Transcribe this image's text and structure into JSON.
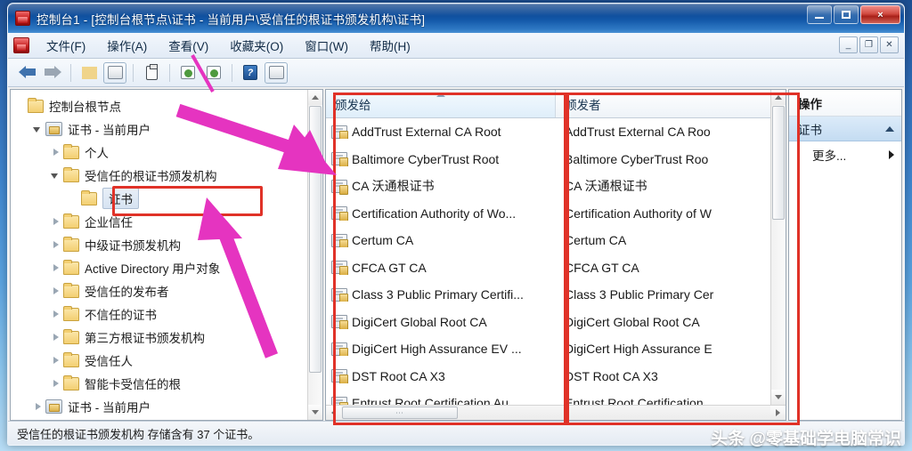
{
  "window": {
    "title": "控制台1 - [控制台根节点\\证书 - 当前用户\\受信任的根证书颁发机构\\证书]",
    "minimize_label": "最小化",
    "restore_label": "还原",
    "close_label": "×",
    "mdi_minimize": "_",
    "mdi_restore": "❐",
    "mdi_close": "✕"
  },
  "menubar": {
    "items": [
      {
        "label": "文件(F)"
      },
      {
        "label": "操作(A)"
      },
      {
        "label": "查看(V)"
      },
      {
        "label": "收藏夹(O)"
      },
      {
        "label": "窗口(W)"
      },
      {
        "label": "帮助(H)"
      }
    ]
  },
  "toolbar": {
    "buttons": [
      {
        "name": "back-icon",
        "tooltip": "后退"
      },
      {
        "name": "forward-icon",
        "tooltip": "前进"
      },
      {
        "name": "up-folder-icon",
        "tooltip": "向上一级"
      },
      {
        "name": "show-hide-tree-icon",
        "tooltip": "显示/隐藏控制台树"
      },
      {
        "name": "properties-icon",
        "tooltip": "属性"
      },
      {
        "name": "refresh-icon",
        "tooltip": "刷新"
      },
      {
        "name": "export-list-icon",
        "tooltip": "导出列表"
      },
      {
        "name": "help-icon",
        "tooltip": "帮助"
      },
      {
        "name": "view-icon",
        "tooltip": "查看"
      }
    ]
  },
  "tree": {
    "nodes": [
      {
        "label": "控制台根节点",
        "indent": 0,
        "twist": "none",
        "icon": "folder",
        "selected": false
      },
      {
        "label": "证书 - 当前用户",
        "indent": 1,
        "twist": "open",
        "icon": "certstore",
        "selected": false
      },
      {
        "label": "个人",
        "indent": 2,
        "twist": "closed",
        "icon": "folder",
        "selected": false
      },
      {
        "label": "受信任的根证书颁发机构",
        "indent": 2,
        "twist": "open",
        "icon": "folder",
        "selected": false
      },
      {
        "label": "证书",
        "indent": 3,
        "twist": "none",
        "icon": "folder",
        "selected": true
      },
      {
        "label": "企业信任",
        "indent": 2,
        "twist": "closed",
        "icon": "folder",
        "selected": false
      },
      {
        "label": "中级证书颁发机构",
        "indent": 2,
        "twist": "closed",
        "icon": "folder",
        "selected": false
      },
      {
        "label": "Active Directory 用户对象",
        "indent": 2,
        "twist": "closed",
        "icon": "folder",
        "selected": false
      },
      {
        "label": "受信任的发布者",
        "indent": 2,
        "twist": "closed",
        "icon": "folder",
        "selected": false
      },
      {
        "label": "不信任的证书",
        "indent": 2,
        "twist": "closed",
        "icon": "folder",
        "selected": false
      },
      {
        "label": "第三方根证书颁发机构",
        "indent": 2,
        "twist": "closed",
        "icon": "folder",
        "selected": false
      },
      {
        "label": "受信任人",
        "indent": 2,
        "twist": "closed",
        "icon": "folder",
        "selected": false
      },
      {
        "label": "智能卡受信任的根",
        "indent": 2,
        "twist": "closed",
        "icon": "folder",
        "selected": false
      },
      {
        "label": "证书 - 当前用户",
        "indent": 1,
        "twist": "closed",
        "icon": "certstore",
        "selected": false
      }
    ]
  },
  "list": {
    "columns": [
      {
        "label": "颁发给",
        "sorted": "asc"
      },
      {
        "label": "颁发者",
        "sorted": "none"
      }
    ],
    "rows": [
      {
        "issued_to": "AddTrust External CA Root",
        "issued_by": "AddTrust External CA Roo"
      },
      {
        "issued_to": "Baltimore CyberTrust Root",
        "issued_by": "Baltimore CyberTrust Roo"
      },
      {
        "issued_to": "CA 沃通根证书",
        "issued_by": "CA 沃通根证书"
      },
      {
        "issued_to": "Certification Authority of Wo...",
        "issued_by": "Certification Authority of W"
      },
      {
        "issued_to": "Certum CA",
        "issued_by": "Certum CA"
      },
      {
        "issued_to": "CFCA GT CA",
        "issued_by": "CFCA GT CA"
      },
      {
        "issued_to": "Class 3 Public Primary Certifi...",
        "issued_by": "Class 3 Public Primary Cer"
      },
      {
        "issued_to": "DigiCert Global Root CA",
        "issued_by": "DigiCert Global Root CA"
      },
      {
        "issued_to": "DigiCert High Assurance EV ...",
        "issued_by": "DigiCert High Assurance E"
      },
      {
        "issued_to": "DST Root CA X3",
        "issued_by": "DST Root CA X3"
      },
      {
        "issued_to": "Entrust Root Certification Au...",
        "issued_by": "Entrust Root Certification"
      }
    ],
    "hscroll_grip": "⋯"
  },
  "actions": {
    "title": "操作",
    "group_label": "证书",
    "items": [
      {
        "label": "更多...",
        "has_submenu": true
      }
    ]
  },
  "statusbar": {
    "text": "受信任的根证书颁发机构 存储含有 37 个证书。"
  },
  "watermark": {
    "text": "头条 @零基础学电脑常识"
  },
  "annotation": {
    "accent_color": "#e03228",
    "arrow_color": "#e534c0"
  }
}
